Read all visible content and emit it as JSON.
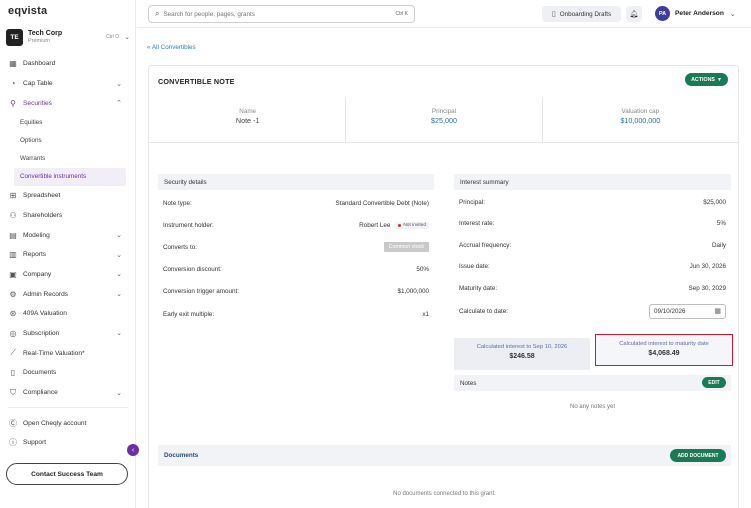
{
  "brand": {
    "logo": "eqvista"
  },
  "company": {
    "initials": "TE",
    "name": "Tech Corp",
    "plan": "Premium",
    "shortcut": "Ctrl O"
  },
  "nav": {
    "dashboard": "Dashboard",
    "cap_table": "Cap Table",
    "securities": "Securities",
    "equities": "Equities",
    "options": "Options",
    "warrants": "Warrants",
    "convertible_instruments": "Convertible instruments",
    "spreadsheet": "Spreadsheet",
    "shareholders": "Shareholders",
    "modeling": "Modeling",
    "reports": "Reports",
    "company": "Company",
    "admin_records": "Admin Records",
    "valuation_409a": "409A Valuation",
    "subscription": "Subscription",
    "real_time_valuation": "Real-Time Valuation*",
    "documents": "Documents",
    "compliance": "Compliance",
    "open_cheqly": "Open Cheqly account",
    "support": "Support"
  },
  "contact_button": "Contact Success Team",
  "search": {
    "placeholder": "Search for people, pages, grants",
    "shortcut": "Ctrl K"
  },
  "topbar": {
    "drafts_label": "Onboarding Drafts"
  },
  "user": {
    "initials": "PA",
    "name": "Peter Anderson"
  },
  "back_link": "« All Convertibles",
  "card": {
    "title": "CONVERTIBLE NOTE",
    "actions_label": "ACTIONS"
  },
  "stats": [
    {
      "label": "Name",
      "value": "Note -1"
    },
    {
      "label": "Principal",
      "value": "$25,000"
    },
    {
      "label": "Valuation cap",
      "value": "$10,000,000"
    }
  ],
  "security_details": {
    "title": "Security details",
    "note_type_label": "Note type:",
    "note_type_value": "Standard Convertible Debt (Note)",
    "holder_label": "Instrument holder:",
    "holder_name": "Robert Lee",
    "holder_status": "Not invited",
    "converts_label": "Converts to:",
    "converts_value": "Common stock",
    "discount_label": "Conversion discount:",
    "discount_value": "50%",
    "trigger_label": "Conversion trigger amount:",
    "trigger_value": "$1,000,000",
    "exit_label": "Early exit multiple:",
    "exit_value": "x1"
  },
  "interest_summary": {
    "title": "Interest summary",
    "principal_label": "Principal:",
    "principal_value": "$25,000",
    "rate_label": "Interest rate:",
    "rate_value": "5%",
    "accrual_label": "Accrual frequency:",
    "accrual_value": "Daily",
    "issue_label": "Issue date:",
    "issue_value": "Jun 30, 2026",
    "maturity_label": "Maturity date:",
    "maturity_value": "Sep 30, 2029",
    "calc_label": "Calculate to date:",
    "calc_value": "09/10/2026"
  },
  "calculated": {
    "to_date_label": "Calculated interest to Sep 10, 2026",
    "to_date_value": "$246.58",
    "to_maturity_label": "Calculated interest to maturity date",
    "to_maturity_value": "$4,068.49"
  },
  "notes": {
    "title": "Notes",
    "edit_label": "EDIT",
    "empty": "No any notes yet"
  },
  "documents": {
    "title": "Documents",
    "add_label": "ADD DOCUMENT",
    "empty": "No documents connected to this grant."
  },
  "colors": {
    "accent": "#6a2fa3",
    "primary_green": "#1a7a55",
    "link_blue": "#2a7fb8",
    "highlight_red": "#d0192b"
  }
}
